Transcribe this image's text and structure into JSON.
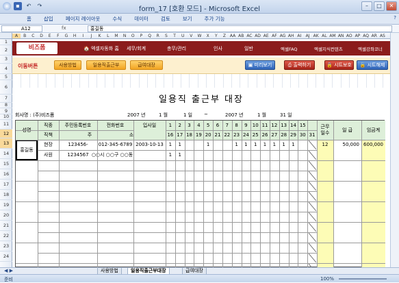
{
  "window": {
    "title": "form_17  [호환 모드] - Microsoft Excel"
  },
  "ribbon_tabs": [
    "홈",
    "삽입",
    "페이지 레이아웃",
    "수식",
    "데이터",
    "검토",
    "보기",
    "추가 기능"
  ],
  "formula_bar": {
    "cell": "A12",
    "fx": "fx",
    "value": "홍길동"
  },
  "column_letters": [
    "A",
    "B",
    "C",
    "D",
    "E",
    "F",
    "G",
    "H",
    "I",
    "J",
    "K",
    "L",
    "M",
    "N",
    "O",
    "P",
    "Q",
    "R",
    "S",
    "T",
    "U",
    "V",
    "W",
    "X",
    "Y",
    "Z",
    "AA",
    "AB",
    "AC",
    "AD",
    "AE",
    "AF",
    "AG",
    "AH",
    "AI",
    "AJ",
    "AK",
    "AL",
    "AM",
    "AN",
    "AO",
    "AP",
    "AQ",
    "AR",
    "AS"
  ],
  "row_numbers": [
    "1",
    "2",
    "3",
    "4",
    "5",
    "6",
    "7",
    "8",
    "9",
    "10",
    "11",
    "12",
    "13",
    "14",
    "15",
    "16",
    "17",
    "18",
    "19",
    "20",
    "21",
    "22",
    "23",
    "24"
  ],
  "header_bar": {
    "logo": "비즈폼",
    "logo_sub": "중소기업 성장파트너 비즈폼",
    "home_link": "엑셀자동화 홈",
    "nav": [
      "세무/회계",
      "총무/관리",
      "인사",
      "일반"
    ],
    "right_links": [
      "엑셀FAQ",
      "엑셀지식컨텐츠",
      "엑셀강좌코너"
    ]
  },
  "button_bar": {
    "label": "이동버튼",
    "orange_buttons": [
      "사용방법",
      "일용직출근부",
      "급여대장"
    ],
    "preview": "미리보기",
    "print": "출력하기",
    "protect": "시트보호",
    "unprotect": "시트해제"
  },
  "document": {
    "title": "일용직 출근부 대장",
    "company_label": "회사명 : (주)비즈폼",
    "from_year": "2007 년",
    "from_month": "1 월",
    "from_day": "1 일",
    "tilde": "~",
    "to_year": "2007 년",
    "to_month": "1 월",
    "to_day": "31 일"
  },
  "table": {
    "headers": {
      "name": "성명",
      "position": "직종",
      "title": "직책",
      "ssn": "주민등록번호",
      "phone": "전화번호",
      "address_label": "주",
      "address_label2": "소",
      "join_date": "입사일",
      "work_days": "근무\n일수",
      "daily_pay": "일 급",
      "total_pay": "임금계"
    },
    "days_top": [
      "1",
      "2",
      "3",
      "4",
      "5",
      "6",
      "7",
      "8",
      "9",
      "10",
      "11",
      "12",
      "13",
      "14",
      "15"
    ],
    "days_bottom": [
      "16",
      "17",
      "18",
      "19",
      "20",
      "21",
      "22",
      "23",
      "24",
      "25",
      "26",
      "27",
      "28",
      "29",
      "30",
      "31"
    ],
    "rows": [
      {
        "name": "홍길동",
        "position": "현장",
        "title": "사원",
        "ssn": "123456-1234567",
        "phone": "012-345-6789",
        "join_date": "2003-10-13",
        "address": "○○시 ○○구 ○○동",
        "marks_top": [
          "1",
          "1",
          "",
          "",
          "1",
          "",
          "",
          "1",
          "1",
          "1",
          "1",
          "1",
          "1",
          "1",
          ""
        ],
        "marks_bottom": [
          "1",
          "1",
          "",
          "",
          "",
          "",
          "",
          "",
          "",
          "",
          "",
          "",
          "",
          "",
          "",
          ""
        ],
        "work_days": "12",
        "daily_pay": "50,000",
        "total_pay": "600,000"
      }
    ]
  },
  "sheet_tabs": [
    "사용방법",
    "일용직출근부대장",
    "급여대장"
  ],
  "status": {
    "ready": "준비",
    "zoom": "100%"
  }
}
